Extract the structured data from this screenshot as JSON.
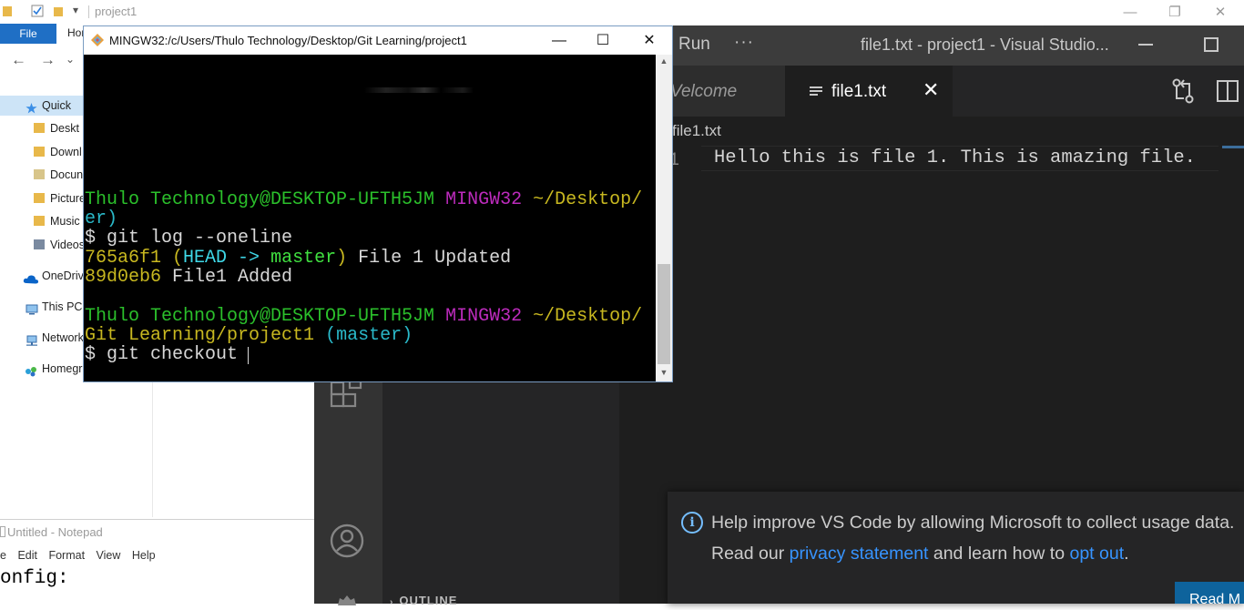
{
  "explorer": {
    "title": "project1",
    "ribbon_file": "File",
    "ribbon_home": "Hor",
    "nav": {
      "back": "←",
      "forward": "→",
      "dropdown": "⌄"
    },
    "sidebar": [
      {
        "label": "Quick",
        "icon": "star-icon",
        "selected": true
      },
      {
        "label": "Deskt",
        "icon": "folder-icon"
      },
      {
        "label": "Downl",
        "icon": "folder-icon"
      },
      {
        "label": "Docun",
        "icon": "folder-icon"
      },
      {
        "label": "Picture",
        "icon": "folder-icon"
      },
      {
        "label": "Music",
        "icon": "folder-icon"
      },
      {
        "label": "Videos",
        "icon": "folder-icon"
      },
      {
        "label": "OneDriv",
        "icon": "cloud-icon"
      },
      {
        "label": "This PC",
        "icon": "pc-icon"
      },
      {
        "label": "Network",
        "icon": "network-icon"
      },
      {
        "label": "Homegr",
        "icon": "homegroup-icon"
      }
    ]
  },
  "notepad": {
    "title": "Untitled - Notepad",
    "menu": [
      "e",
      "Edit",
      "Format",
      "View",
      "Help"
    ],
    "text": "onfig:"
  },
  "vscode": {
    "menu_run": "Run",
    "menu_more": "···",
    "window_title": "file1.txt - project1 - Visual Studio...",
    "tabs": [
      {
        "label": "Velcome",
        "active": false
      },
      {
        "label": "file1.txt",
        "active": true
      }
    ],
    "tab_close": "✕",
    "breadcrumb": "file1.txt",
    "line_number": "1",
    "code_line": "Hello this is file 1. This is amazing file.",
    "sidebar_section": "OUTLINE",
    "notification": {
      "icon": "i",
      "message": "Help improve VS Code by allowing Microsoft to collect usage data.",
      "line2_prefix": "Read our ",
      "link1": "privacy statement",
      "line2_mid": " and learn how to ",
      "link2": "opt out",
      "line2_suffix": ".",
      "button": "Read M"
    },
    "colors": {
      "background": "#1e1e1e",
      "activity_bar": "#333333",
      "sidebar": "#252526",
      "link": "#3794ff",
      "button": "#0e639c"
    }
  },
  "bash": {
    "title": "MINGW32:/c/Users/Thulo Technology/Desktop/Git Learning/project1",
    "controls": {
      "minimize": "—",
      "maximize": "☐",
      "close": "✕"
    },
    "prompt1": {
      "user": "Thulo Technology@DESKTOP-UFTH5JM",
      "shell": "MINGW32",
      "path": "~/Desktop/"
    },
    "prompt1_cont": "er)",
    "cmd1": "$ git log --oneline",
    "log": [
      {
        "hash": "765a6f1",
        "refs_open": "(",
        "head": "HEAD -> ",
        "branch": "master",
        "refs_close": ")",
        "msg": "File 1 Updated"
      },
      {
        "hash": "89d0eb6",
        "msg": "File1 Added"
      }
    ],
    "prompt2": {
      "user": "Thulo Technology@DESKTOP-UFTH5JM",
      "shell": "MINGW32",
      "path": "~/Desktop/"
    },
    "prompt2_cont": "Git Learning/project1",
    "prompt2_branch": "(master)",
    "cmd2": "$ git checkout ",
    "colors": {
      "user": "#2bc02b",
      "shell": "#bc2bbc",
      "path": "#c8b820",
      "branch": "#2ab8c8"
    }
  }
}
